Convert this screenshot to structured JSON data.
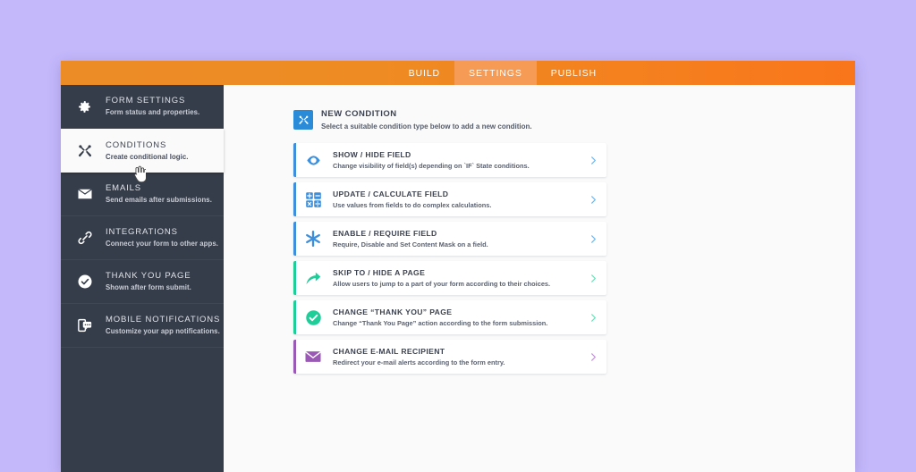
{
  "theme": {
    "page_background": "#c4b8fb",
    "topbar_gradient_from": "#ec8c27",
    "topbar_gradient_to": "#f9761a",
    "tab_active_background": "#f59b55",
    "sidebar_background": "#363d4a",
    "accent_blue": "#3d8fdb",
    "accent_teal": "#1ecd97",
    "accent_purple": "#9b59b6"
  },
  "topbar": {
    "tabs": [
      {
        "label": "BUILD",
        "active": false
      },
      {
        "label": "SETTINGS",
        "active": true
      },
      {
        "label": "PUBLISH",
        "active": false
      }
    ]
  },
  "sidebar": {
    "items": [
      {
        "icon": "gear-icon",
        "title": "FORM SETTINGS",
        "subtitle": "Form status and properties.",
        "active": false
      },
      {
        "icon": "tools-icon",
        "title": "CONDITIONS",
        "subtitle": "Create conditional logic.",
        "active": true
      },
      {
        "icon": "envelope-icon",
        "title": "EMAILS",
        "subtitle": "Send emails after submissions.",
        "active": false
      },
      {
        "icon": "chain-link-icon",
        "title": "INTEGRATIONS",
        "subtitle": "Connect your form to other apps.",
        "active": false
      },
      {
        "icon": "check-circle-icon",
        "title": "THANK YOU PAGE",
        "subtitle": "Shown after form submit.",
        "active": false
      },
      {
        "icon": "mobile-notification-icon",
        "title": "MOBILE NOTIFICATIONS",
        "subtitle": "Customize your app notifications.",
        "active": false
      }
    ]
  },
  "main": {
    "section": {
      "icon": "tools-icon",
      "title": "NEW CONDITION",
      "subtitle": "Select a suitable condition type below to add a new condition."
    },
    "conditions": [
      {
        "icon": "eye-icon",
        "title": "SHOW / HIDE FIELD",
        "subtitle": "Change visibility of field(s) depending on `IF` State conditions.",
        "color": "#3d8fdb"
      },
      {
        "icon": "calculator-icon",
        "title": "UPDATE / CALCULATE FIELD",
        "subtitle": "Use values from fields to do complex calculations.",
        "color": "#3d8fdb"
      },
      {
        "icon": "asterisk-icon",
        "title": "ENABLE / REQUIRE FIELD",
        "subtitle": "Require, Disable and Set Content Mask on a field.",
        "color": "#3d8fdb"
      },
      {
        "icon": "curved-arrow-icon",
        "title": "SKIP TO / HIDE A PAGE",
        "subtitle": "Allow users to jump to a part of your form according to their choices.",
        "color": "#1ecd97"
      },
      {
        "icon": "check-circle-icon",
        "title": "CHANGE “THANK YOU” PAGE",
        "subtitle": "Change “Thank You Page” action according to the form submission.",
        "color": "#1ecd97"
      },
      {
        "icon": "envelope-icon",
        "title": "CHANGE E-MAIL RECIPIENT",
        "subtitle": "Redirect your e-mail alerts according to the form entry.",
        "color": "#9b59b6"
      }
    ],
    "chevron_icon": "chevron-right-icon"
  }
}
